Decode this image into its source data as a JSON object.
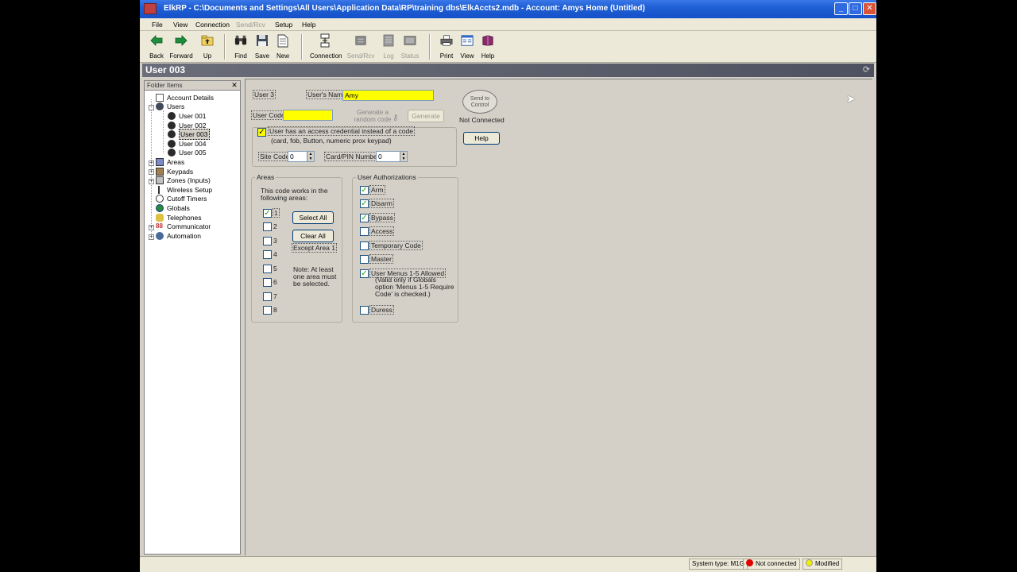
{
  "window": {
    "title": "ElkRP - C:\\Documents and Settings\\All Users\\Application Data\\RP\\training dbs\\ElkAccts2.mdb - Account: Amys Home (Untitled)",
    "controls": [
      "minimize",
      "maximize",
      "close"
    ]
  },
  "menu": {
    "items": [
      {
        "label": "File",
        "enabled": true
      },
      {
        "label": "View",
        "enabled": true
      },
      {
        "label": "Connection",
        "enabled": true
      },
      {
        "label": "Send/Rcv",
        "enabled": false
      },
      {
        "label": "Setup",
        "enabled": true
      },
      {
        "label": "Help",
        "enabled": true
      }
    ]
  },
  "toolbar": {
    "buttons": [
      {
        "label": "Back",
        "icon": "back-arrow-icon",
        "enabled": true
      },
      {
        "label": "Forward",
        "icon": "forward-arrow-icon",
        "enabled": true
      },
      {
        "label": "Up",
        "icon": "folder-up-icon",
        "enabled": true
      },
      {
        "label": "Find",
        "icon": "binoculars-icon",
        "enabled": true
      },
      {
        "label": "Save",
        "icon": "floppy-disk-icon",
        "enabled": true
      },
      {
        "label": "New",
        "icon": "new-document-icon",
        "enabled": true
      },
      {
        "label": "Connection",
        "icon": "connection-icon",
        "enabled": true
      },
      {
        "label": "Send/Rcv",
        "icon": "send-receive-icon",
        "enabled": false
      },
      {
        "label": "Log",
        "icon": "log-icon",
        "enabled": false
      },
      {
        "label": "Status",
        "icon": "status-icon",
        "enabled": false
      },
      {
        "label": "Print",
        "icon": "printer-icon",
        "enabled": true
      },
      {
        "label": "View",
        "icon": "view-icon",
        "enabled": true
      },
      {
        "label": "Help",
        "icon": "help-book-icon",
        "enabled": true
      }
    ]
  },
  "caption": {
    "title": "User 003"
  },
  "folder_pane": {
    "title": "Folder Items",
    "items": [
      {
        "label": "Account Details",
        "icon": "account-details-icon",
        "depth": 0,
        "expander": ""
      },
      {
        "label": "Users",
        "icon": "users-icon",
        "depth": 0,
        "expander": "-"
      },
      {
        "label": "User 001",
        "icon": "user-icon",
        "depth": 1,
        "expander": ""
      },
      {
        "label": "User 002",
        "icon": "user-icon",
        "depth": 1,
        "expander": ""
      },
      {
        "label": "User 003",
        "icon": "user-icon",
        "depth": 1,
        "expander": "",
        "selected": true
      },
      {
        "label": "User 004",
        "icon": "user-icon",
        "depth": 1,
        "expander": ""
      },
      {
        "label": "User 005",
        "icon": "user-icon",
        "depth": 1,
        "expander": ""
      },
      {
        "label": "Areas",
        "icon": "areas-icon",
        "depth": 0,
        "expander": "+"
      },
      {
        "label": "Keypads",
        "icon": "keypad-icon",
        "depth": 0,
        "expander": "+"
      },
      {
        "label": "Zones (Inputs)",
        "icon": "zones-icon",
        "depth": 0,
        "expander": "+"
      },
      {
        "label": "Wireless Setup",
        "icon": "wireless-icon",
        "depth": 0,
        "expander": ""
      },
      {
        "label": "Cutoff Timers",
        "icon": "timer-icon",
        "depth": 0,
        "expander": ""
      },
      {
        "label": "Globals",
        "icon": "globe-icon",
        "depth": 0,
        "expander": ""
      },
      {
        "label": "Telephones",
        "icon": "telephone-icon",
        "depth": 0,
        "expander": ""
      },
      {
        "label": "Communicator",
        "icon": "communicator-icon",
        "depth": 0,
        "expander": "+"
      },
      {
        "label": "Automation",
        "icon": "automation-icon",
        "depth": 0,
        "expander": "+"
      }
    ]
  },
  "user_form": {
    "user_number": "User 3",
    "user_name_label": "User's Name",
    "user_name_value": "Amy",
    "user_code_label": "User Code",
    "user_code_value": "",
    "generate_random_label": "Generate a random code",
    "generate_button": "Generate",
    "credential_checkbox_label": "User has an access credential instead of a code",
    "credential_checkbox_sub": "(card, fob, Button, numeric prox keypad)",
    "credential_checked": true,
    "site_code_label": "Site Code",
    "site_code_value": "0",
    "card_pin_label": "Card/PIN Number",
    "card_pin_value": "0",
    "send_to_control_label": "Send to Control",
    "connection_status": "Not Connected",
    "help_button": "Help"
  },
  "areas_group": {
    "title": "Areas",
    "description": "This code works in the following areas:",
    "areas": [
      {
        "label": "1",
        "checked": true
      },
      {
        "label": "2",
        "checked": false
      },
      {
        "label": "3",
        "checked": false
      },
      {
        "label": "4",
        "checked": false
      },
      {
        "label": "5",
        "checked": false
      },
      {
        "label": "6",
        "checked": false
      },
      {
        "label": "7",
        "checked": false
      },
      {
        "label": "8",
        "checked": false
      }
    ],
    "select_all_button": "Select All",
    "clear_all_button": "Clear All",
    "except_area_label": "Except Area 1",
    "note": "Note: At least one area must be selected."
  },
  "authorizations_group": {
    "title": "User Authorizations",
    "items": [
      {
        "label": "Arm",
        "checked": true
      },
      {
        "label": "Disarm",
        "checked": true
      },
      {
        "label": "Bypass",
        "checked": true
      },
      {
        "label": "Access",
        "checked": false
      },
      {
        "label": "Temporary Code",
        "checked": false
      },
      {
        "label": "Master",
        "checked": false
      },
      {
        "label": "User Menus 1-5 Allowed",
        "checked": true,
        "sub": "(Valid only if Globals option 'Menus 1-5 Require Code' is checked.)"
      },
      {
        "label": "Duress",
        "checked": false
      }
    ]
  },
  "status": {
    "system_type": "System type: M1G",
    "connection": "Not connected",
    "connection_color": "#e00000",
    "modified": "Modified",
    "modified_color": "#f0f000"
  },
  "colors": {
    "title_bar": "#1f5fd4",
    "caption_bar": "#5a5e6b",
    "field_highlight": "#ffff00",
    "window_face": "#d4d0c8"
  }
}
